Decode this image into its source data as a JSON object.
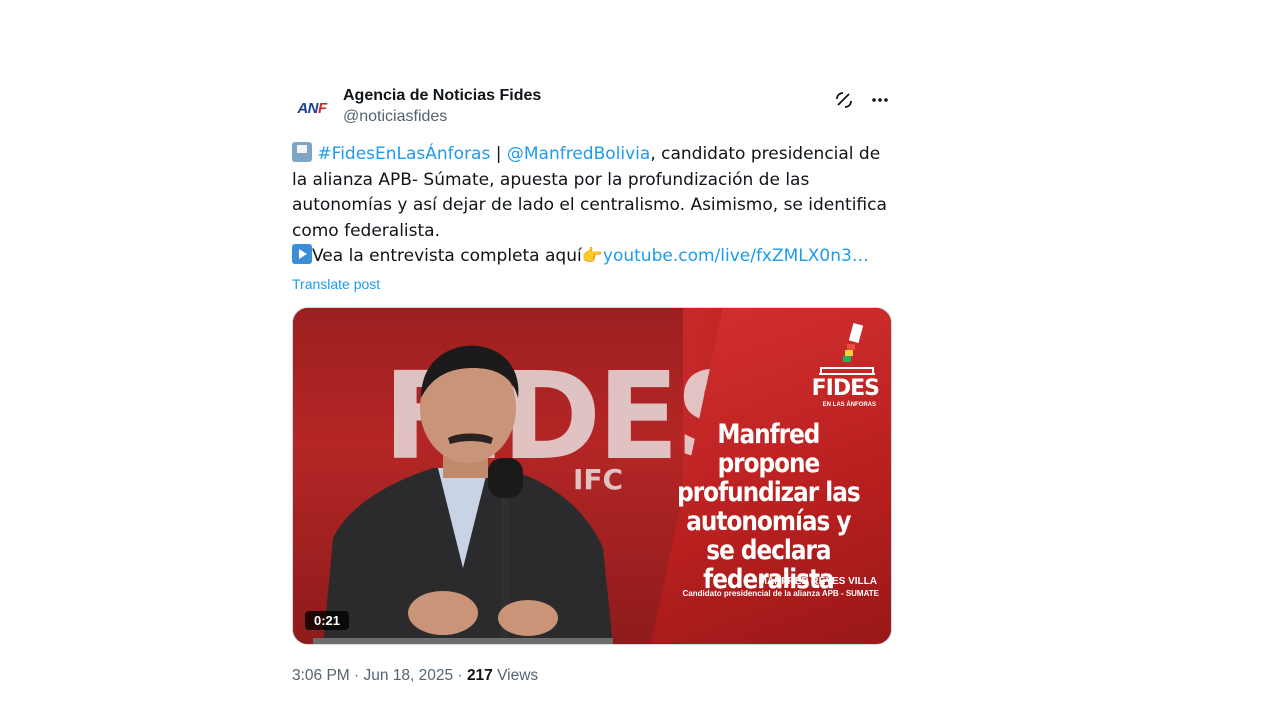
{
  "account": {
    "display_name": "Agencia de Noticias Fides",
    "handle": "@noticiasfides",
    "avatar_text_blue": "AN",
    "avatar_text_red": "F"
  },
  "header_icons": {
    "grok": "grok-icon",
    "more": "more-icon"
  },
  "post": {
    "hashtag": "#FidesEnLasÁnforas",
    "separator": " | ",
    "mention": "@ManfredBolivia",
    "text_main": ", candidato presidencial de la alianza APB- Súmate, apuesta por la profundización de las autonomías y así dejar de lado el centralismo. Asimismo, se identifica como federalista.",
    "text_interview": "Vea la entrevista completa aquí",
    "link": "youtube.com/live/fxZMLX0n3…",
    "translate_label": "Translate post"
  },
  "media": {
    "backdrop_text": "FIDES",
    "backdrop_text_small": "IFC",
    "logo_word": "FIDES",
    "logo_sub": "EN LAS ÁNFORAS",
    "headline": "Manfred propone profundizar las autonomías y se declara federalista",
    "caption_name": "MANFRED REYES VILLA",
    "caption_role": "Candidato presidencial de la alianza APB - SUMATE",
    "duration": "0:21"
  },
  "meta": {
    "time": "3:06 PM",
    "dot1": " · ",
    "date": "Jun 18, 2025",
    "dot2": " · ",
    "views_count": "217",
    "views_label": " Views"
  },
  "colors": {
    "link": "#1d9bf0",
    "text": "#0f1419",
    "secondary": "#536471",
    "media_red": "#c62828"
  }
}
